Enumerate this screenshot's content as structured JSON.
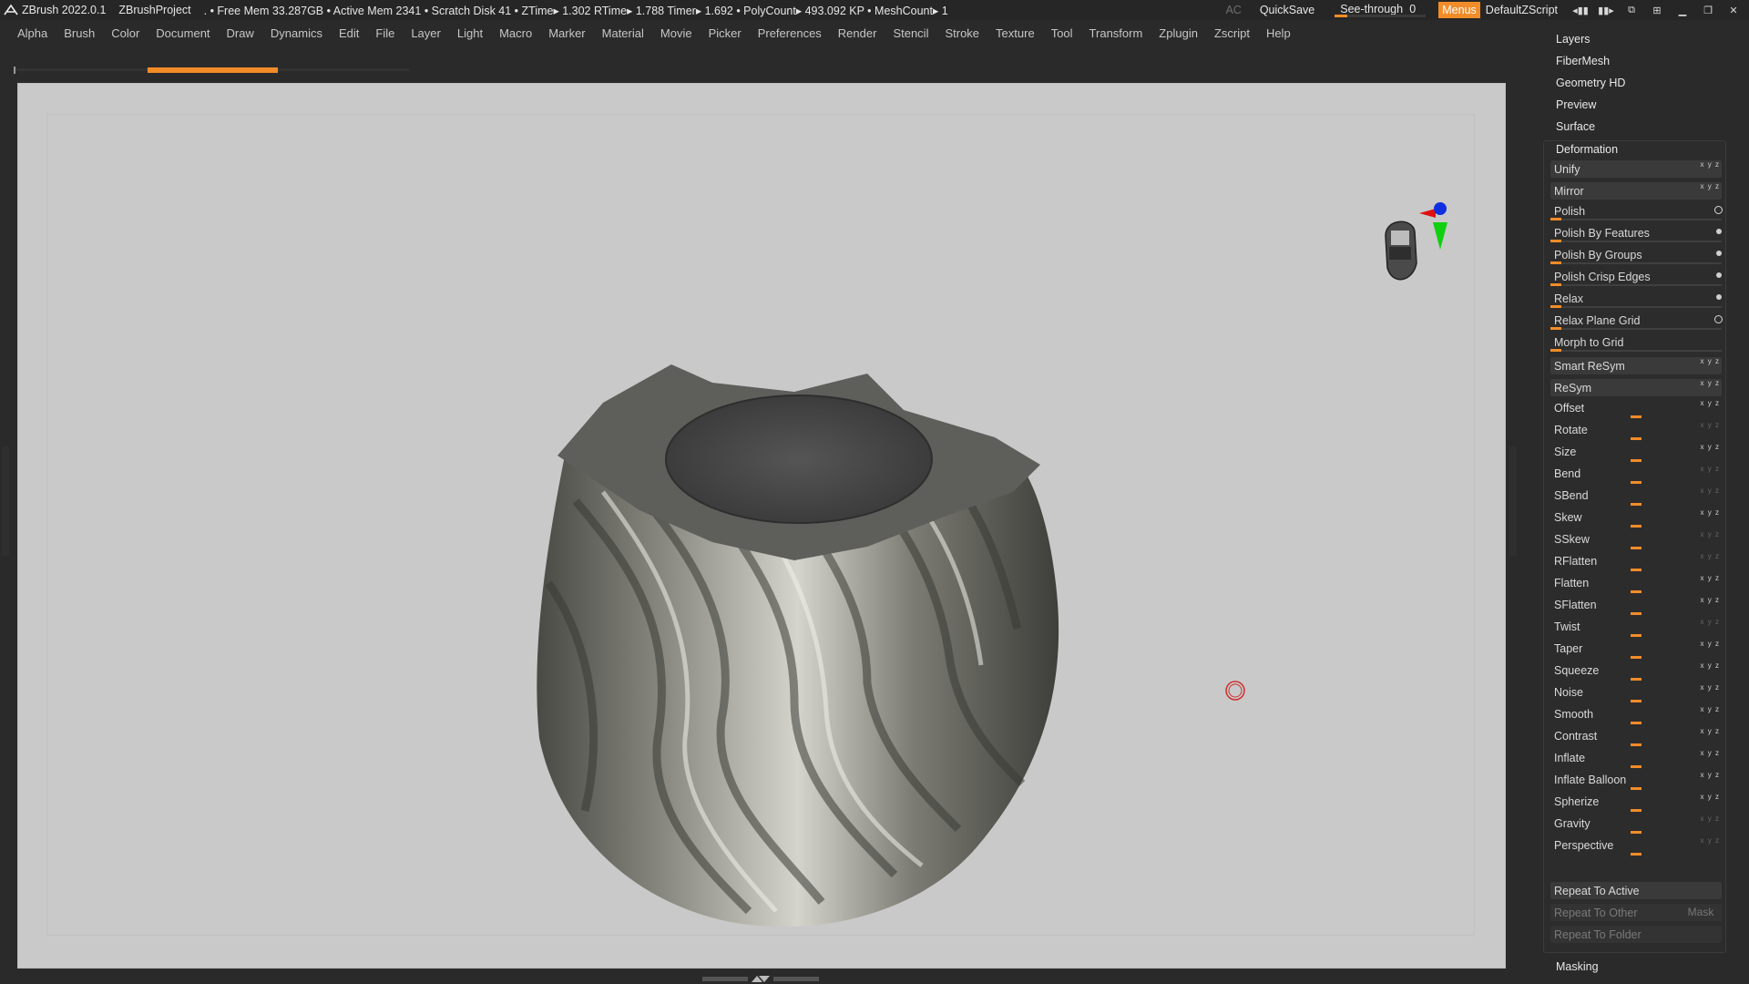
{
  "titlebar": {
    "app": "ZBrush 2022.0.1",
    "project": "ZBrushProject",
    "stats": ". • Free Mem 33.287GB • Active Mem 2341 • Scratch Disk 41 •  ZTime▸ 1.302 RTime▸ 1.788 Timer▸ 1.692 • PolyCount▸ 493.092 KP  • MeshCount▸ 1",
    "ac": "AC",
    "quicksave": "QuickSave",
    "seethrough_label": "See-through",
    "seethrough_value": "0",
    "menus": "Menus",
    "script": "DefaultZScript"
  },
  "menubar": [
    "Alpha",
    "Brush",
    "Color",
    "Document",
    "Draw",
    "Dynamics",
    "Edit",
    "File",
    "Layer",
    "Light",
    "Macro",
    "Marker",
    "Material",
    "Movie",
    "Picker",
    "Preferences",
    "Render",
    "Stencil",
    "Stroke",
    "Texture",
    "Tool",
    "Transform",
    "Zplugin",
    "Zscript",
    "Help"
  ],
  "progress": {
    "fraction": 0.33
  },
  "panel": {
    "sections": [
      "Layers",
      "FiberMesh",
      "Geometry HD",
      "Preview",
      "Surface"
    ],
    "deformation_title": "Deformation",
    "buttons_top": [
      "Unify",
      "Mirror"
    ],
    "polish": [
      "Polish",
      "Polish By Features",
      "Polish By Groups",
      "Polish Crisp Edges",
      "Relax",
      "Relax Plane Grid",
      "Morph to Grid"
    ],
    "resym": [
      "Smart ReSym",
      "ReSym"
    ],
    "sliders": [
      "Offset",
      "Rotate",
      "Size",
      "Bend",
      "SBend",
      "Skew",
      "SSkew",
      "RFlatten",
      "Flatten",
      "SFlatten",
      "Twist",
      "Taper",
      "Squeeze",
      "Noise",
      "Smooth",
      "Contrast",
      "Inflate",
      "Inflate Balloon",
      "Spherize",
      "Gravity",
      "Perspective"
    ],
    "repeat_active": "Repeat To Active",
    "repeat_other": "Repeat To Other",
    "mask": "Mask",
    "repeat_folder": "Repeat To Folder",
    "masking": "Masking"
  },
  "colors": {
    "accent": "#f28c28",
    "viewport": "#c9c9c9",
    "panel": "#2a2a2a"
  }
}
